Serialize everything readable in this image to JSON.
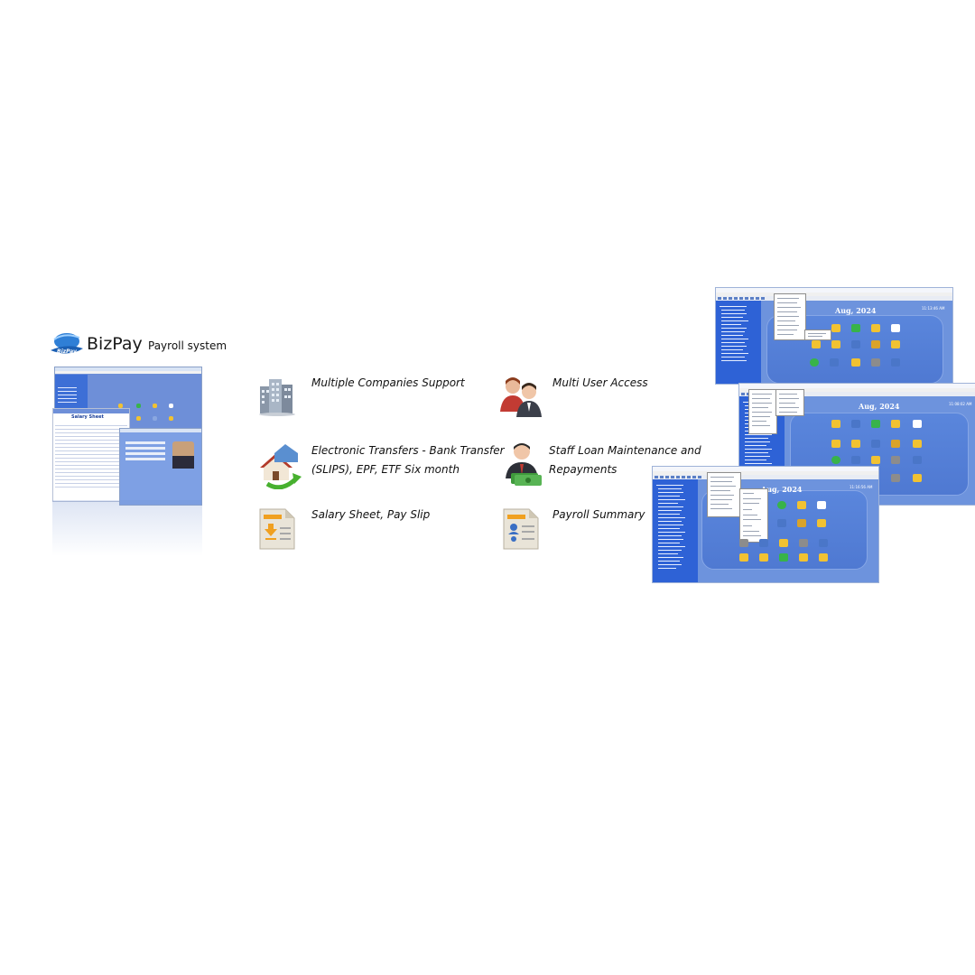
{
  "brand": {
    "name": "BizPay",
    "tagline": "Payroll system",
    "mark_text": "BizPay"
  },
  "features": [
    {
      "icon": "office-buildings-icon",
      "text": "Multiple Companies Support"
    },
    {
      "icon": "users-icon",
      "text": "Multi User Access"
    },
    {
      "icon": "money-transfer-icon",
      "text_line1": "Electronic Transfers - Bank Transfer",
      "text_line2": "(SLIPS), EPF, ETF Six month"
    },
    {
      "icon": "staff-loan-icon",
      "text_line1": "Staff Loan Maintenance and",
      "text_line2": "Repayments"
    },
    {
      "icon": "document-sheet-icon",
      "text": "Salary Sheet, Pay Slip"
    },
    {
      "icon": "payroll-summary-icon",
      "text": "Payroll Summary"
    }
  ],
  "screenshots": [
    {
      "month": "Aug, 2024",
      "clock": "11:13:46 AM"
    },
    {
      "month": "Aug, 2024",
      "clock": "11:08:02 AM"
    },
    {
      "month": "Aug, 2024",
      "clock": "11:16:56 AM"
    }
  ],
  "left_screenshot": {
    "sheet_title": "Salary Sheet"
  },
  "colors": {
    "app_blue": "#6d93dd",
    "tree_blue": "#2e62d6",
    "panel_blue": "#5a86dc"
  }
}
